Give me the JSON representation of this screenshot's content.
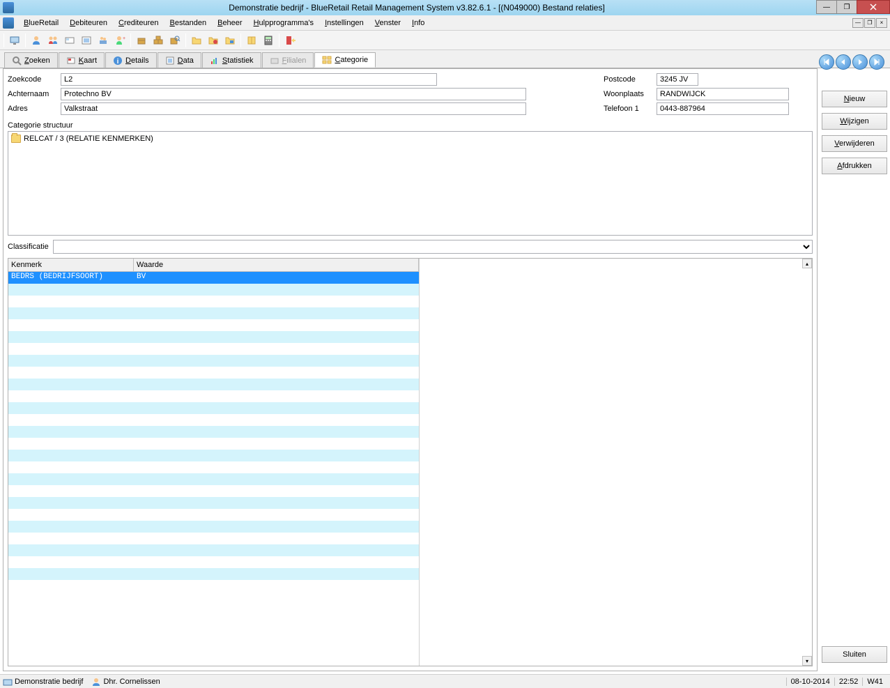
{
  "window": {
    "title": "Demonstratie bedrijf - BlueRetail Retail Management System v3.82.6.1 - [(N049000) Bestand relaties]"
  },
  "menu": {
    "items": [
      "BlueRetail",
      "Debiteuren",
      "Crediteuren",
      "Bestanden",
      "Beheer",
      "Hulpprogramma's",
      "Instellingen",
      "Venster",
      "Info"
    ]
  },
  "tabs": {
    "items": [
      "Zoeken",
      "Kaart",
      "Details",
      "Data",
      "Statistiek",
      "Filialen",
      "Categorie"
    ],
    "disabled_index": 5,
    "active_index": 6
  },
  "form": {
    "zoekcode": {
      "label": "Zoekcode",
      "value": "L2"
    },
    "achternaam": {
      "label": "Achternaam",
      "value": "Protechno BV"
    },
    "adres": {
      "label": "Adres",
      "value": "Valkstraat"
    },
    "postcode": {
      "label": "Postcode",
      "value": "3245 JV"
    },
    "woonplaats": {
      "label": "Woonplaats",
      "value": "RANDWIJCK"
    },
    "telefoon1": {
      "label": "Telefoon 1",
      "value": "0443-887964"
    }
  },
  "category": {
    "label": "Categorie structuur",
    "tree_item": "RELCAT / 3 (RELATIE KENMERKEN)"
  },
  "classification": {
    "label": "Classificatie",
    "value": ""
  },
  "grid": {
    "col1": "Kenmerk",
    "col2": "Waarde",
    "rows": [
      {
        "kenmerk": "BEDRS (BEDRIJFSOORT)",
        "waarde": "BV"
      }
    ]
  },
  "buttons": {
    "nieuw": "Nieuw",
    "wijzigen": "Wijzigen",
    "verwijderen": "Verwijderen",
    "afdrukken": "Afdrukken",
    "sluiten": "Sluiten"
  },
  "status": {
    "company": "Demonstratie bedrijf",
    "user": "Dhr. Cornelissen",
    "date": "08-10-2014",
    "time": "22:52",
    "week": "W41"
  }
}
